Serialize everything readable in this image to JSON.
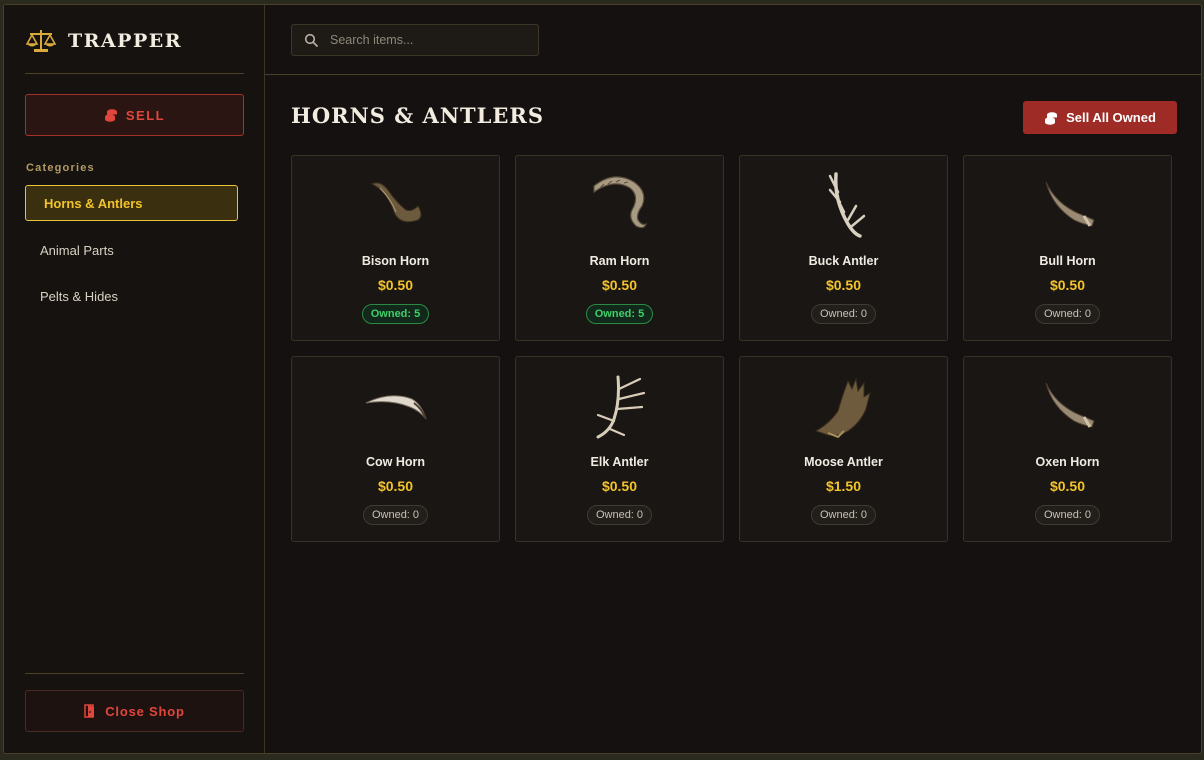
{
  "brand": {
    "title": "TRAPPER",
    "icon": "scales-icon"
  },
  "sidebar": {
    "sell_label": "SELL",
    "categories_heading": "Categories",
    "categories": [
      {
        "label": "Horns & Antlers",
        "active": true
      },
      {
        "label": "Animal Parts",
        "active": false
      },
      {
        "label": "Pelts & Hides",
        "active": false
      }
    ],
    "close_label": "Close Shop"
  },
  "search": {
    "placeholder": "Search items..."
  },
  "main": {
    "title": "HORNS & ANTLERS",
    "sell_all_label": "Sell All Owned"
  },
  "items": [
    {
      "name": "Bison Horn",
      "price": "$0.50",
      "owned": "Owned: 5",
      "has_owned": true
    },
    {
      "name": "Ram Horn",
      "price": "$0.50",
      "owned": "Owned: 5",
      "has_owned": true
    },
    {
      "name": "Buck Antler",
      "price": "$0.50",
      "owned": "Owned: 0",
      "has_owned": false
    },
    {
      "name": "Bull Horn",
      "price": "$0.50",
      "owned": "Owned: 0",
      "has_owned": false
    },
    {
      "name": "Cow Horn",
      "price": "$0.50",
      "owned": "Owned: 0",
      "has_owned": false
    },
    {
      "name": "Elk Antler",
      "price": "$0.50",
      "owned": "Owned: 0",
      "has_owned": false
    },
    {
      "name": "Moose Antler",
      "price": "$1.50",
      "owned": "Owned: 0",
      "has_owned": false
    },
    {
      "name": "Oxen Horn",
      "price": "$0.50",
      "owned": "Owned: 0",
      "has_owned": false
    }
  ],
  "colors": {
    "accent": "#f3c32b",
    "danger": "#e0463c",
    "success": "#3fcf6a"
  }
}
